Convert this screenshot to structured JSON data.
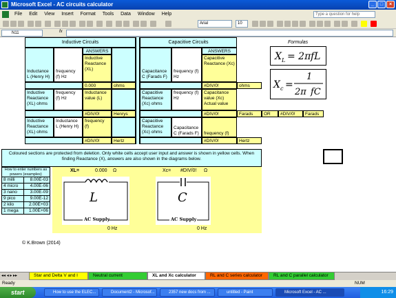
{
  "window": {
    "title": "Microsoft Excel - AC circuits calculator"
  },
  "menu": [
    "File",
    "Edit",
    "View",
    "Insert",
    "Format",
    "Tools",
    "Data",
    "Window",
    "Help"
  ],
  "help_placeholder": "Type a question for help",
  "toolbar": {
    "font": "Arial",
    "size": "10"
  },
  "formula_bar": {
    "name_box": "N11",
    "fx": "fx"
  },
  "sheet": {
    "inductive_header": "Inductive Circuits",
    "capacitive_header": "Capacitive Circuits",
    "answers_label": "ANSWERS",
    "formulas_label": "Formulas",
    "ind_row1": {
      "c1": "Inductance L (Henry H)",
      "c2": "frequency (f) Hz",
      "c3": "Inductive Reactance (XL)",
      "val": "0.000",
      "unit": "ohms"
    },
    "cap_row1": {
      "c1": "Capacitance C (Farads F)",
      "c2": "frequency (f) Hz",
      "c3": "Capacitive Reactance (Xc)",
      "val": "#DIV/0!",
      "unit": "ohms"
    },
    "ind_row2": {
      "c1": "Inductive Reactance (XL) ohms",
      "c2": "frequency (f) Hz",
      "c3": "Inductance value (L)",
      "val": "#DIV/0!",
      "unit": "Henrys"
    },
    "cap_row2": {
      "c1": "Capacitive Reactance (Xc) ohms",
      "c2": "frequency (f) Hz",
      "c3": "Capacitance value (Xc) Actual value",
      "val": "#DIV/0!",
      "unit": "Farads",
      "or": "OR",
      "val2": "#DIV/0!",
      "unit2": "Farads"
    },
    "ind_row3": {
      "c1": "Inductive Reactance (XL) ohms",
      "c2": "Inductance L (Henry H)",
      "c3": "frequency (f)",
      "val": "#DIV/0!",
      "unit": "Hertz"
    },
    "cap_row3": {
      "c1": "Capacitive Reactance (Xc) ohms",
      "c2": "Capacitance C (Farads F)",
      "c3": "frequency (f)",
      "val": "#DIV/0!",
      "unit": "Hertz"
    },
    "note": "Coloured sections are protected from deletion. Only white cells accept user input and answer is shown in yellow cells. When finding Reactance (X), answers are also shown in the diagrams below.",
    "powers_title": "How to enter numbers as powers (examples)",
    "powers": [
      {
        "name": "8 milli",
        "value": "8.00E-03"
      },
      {
        "name": "4 micro",
        "value": "4.00E-06"
      },
      {
        "name": "3 nano",
        "value": "3.00E-09"
      },
      {
        "name": "9 pico",
        "value": "9.00E-12"
      },
      {
        "name": "2 kilo",
        "value": "2.00E+03"
      },
      {
        "name": "1 mega",
        "value": "1.00E+06"
      }
    ],
    "xl_label": "XL=",
    "xl_value": "0.000",
    "xl_unit": "Ω",
    "xc_label": "Xc=",
    "xc_value": "#DIV/0!",
    "xc_unit": "Ω",
    "inductor_letter": "L",
    "capacitor_letter": "C",
    "ac_supply": "AC Supply",
    "ind_hz": "0 Hz",
    "cap_hz": "0 Hz",
    "copyright": "© K.Brown (2014)"
  },
  "tabs": [
    {
      "label": "Star and Delta V and I",
      "color": "#ffff00"
    },
    {
      "label": "Neutral current calculator",
      "color": "#33cc33"
    },
    {
      "label": "XL and Xc calculator",
      "color": "#ffffff"
    },
    {
      "label": "RL and C series calculator",
      "color": "#ff6600"
    },
    {
      "label": "RL and C parallel calculator",
      "color": "#33cc33"
    }
  ],
  "status": {
    "left": "Ready",
    "num": "NUM"
  },
  "taskbar": {
    "start": "start",
    "tasks": [
      "How to use the ELEC...",
      "Document2 - Microsof...",
      "2357 new docs from ...",
      "untitled - Paint",
      "Microsoft Excel - AC ..."
    ],
    "time": "16:29"
  }
}
